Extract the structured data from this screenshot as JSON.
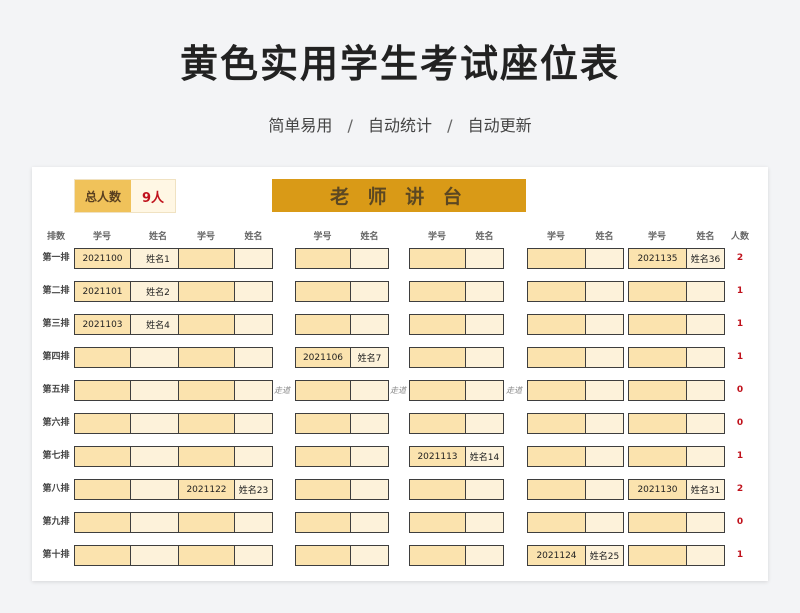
{
  "title": "黄色实用学生考试座位表",
  "subtitle": {
    "part1": "简单易用",
    "sep": "/",
    "part2": "自动统计",
    "part3": "自动更新"
  },
  "total": {
    "label": "总人数",
    "value": "9人"
  },
  "teacher_label": "老 师 讲 台",
  "headers": {
    "row": "排数",
    "id": "学号",
    "name": "姓名",
    "count": "人数"
  },
  "aisle_label": "走道",
  "rows": [
    {
      "label": "第一排",
      "count": "2",
      "seats": [
        [
          "2021100",
          "姓名1"
        ],
        [
          "",
          ""
        ],
        [
          "",
          ""
        ],
        [
          "",
          ""
        ],
        [
          "",
          ""
        ],
        [
          "2021135",
          "姓名36"
        ]
      ]
    },
    {
      "label": "第二排",
      "count": "1",
      "seats": [
        [
          "2021101",
          "姓名2"
        ],
        [
          "",
          ""
        ],
        [
          "",
          ""
        ],
        [
          "",
          ""
        ],
        [
          "",
          ""
        ],
        [
          "",
          ""
        ]
      ]
    },
    {
      "label": "第三排",
      "count": "1",
      "seats": [
        [
          "2021103",
          "姓名4"
        ],
        [
          "",
          ""
        ],
        [
          "",
          ""
        ],
        [
          "",
          ""
        ],
        [
          "",
          ""
        ],
        [
          "",
          ""
        ]
      ]
    },
    {
      "label": "第四排",
      "count": "1",
      "seats": [
        [
          "",
          ""
        ],
        [
          "",
          ""
        ],
        [
          "2021106",
          "姓名7"
        ],
        [
          "",
          ""
        ],
        [
          "",
          ""
        ],
        [
          "",
          ""
        ]
      ]
    },
    {
      "label": "第五排",
      "count": "0",
      "seats": [
        [
          "",
          ""
        ],
        [
          "",
          ""
        ],
        [
          "",
          ""
        ],
        [
          "",
          ""
        ],
        [
          "",
          ""
        ],
        [
          "",
          ""
        ]
      ]
    },
    {
      "label": "第六排",
      "count": "0",
      "seats": [
        [
          "",
          ""
        ],
        [
          "",
          ""
        ],
        [
          "",
          ""
        ],
        [
          "",
          ""
        ],
        [
          "",
          ""
        ],
        [
          "",
          ""
        ]
      ]
    },
    {
      "label": "第七排",
      "count": "1",
      "seats": [
        [
          "",
          ""
        ],
        [
          "",
          ""
        ],
        [
          "",
          ""
        ],
        [
          "2021113",
          "姓名14"
        ],
        [
          "",
          ""
        ],
        [
          "",
          ""
        ]
      ]
    },
    {
      "label": "第八排",
      "count": "2",
      "seats": [
        [
          "",
          ""
        ],
        [
          "2021122",
          "姓名23"
        ],
        [
          "",
          ""
        ],
        [
          "",
          ""
        ],
        [
          "",
          ""
        ],
        [
          "2021130",
          "姓名31"
        ]
      ]
    },
    {
      "label": "第九排",
      "count": "0",
      "seats": [
        [
          "",
          ""
        ],
        [
          "",
          ""
        ],
        [
          "",
          ""
        ],
        [
          "",
          ""
        ],
        [
          "",
          ""
        ],
        [
          "",
          ""
        ]
      ]
    },
    {
      "label": "第十排",
      "count": "1",
      "seats": [
        [
          "",
          ""
        ],
        [
          "",
          ""
        ],
        [
          "",
          ""
        ],
        [
          "",
          ""
        ],
        [
          "2021124",
          "姓名25"
        ],
        [
          "",
          ""
        ]
      ]
    }
  ]
}
